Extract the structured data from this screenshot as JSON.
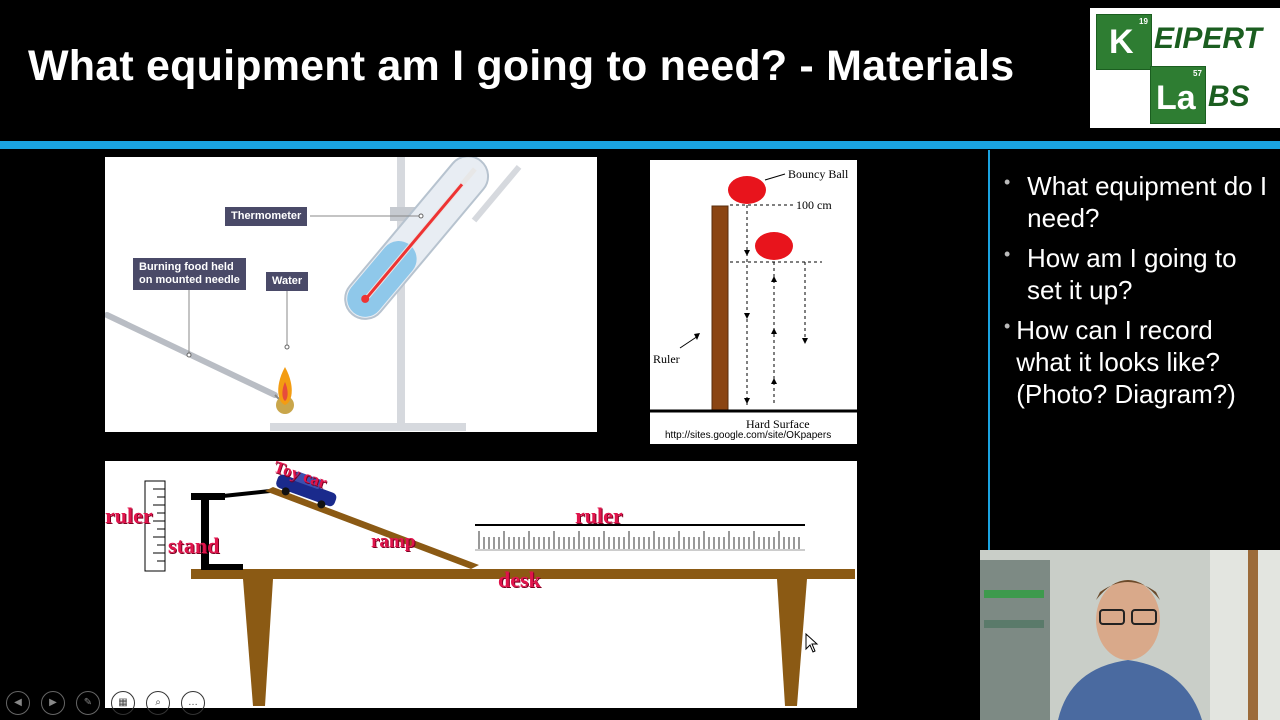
{
  "slide": {
    "title": "What equipment am I going to need? - Materials"
  },
  "logo": {
    "k": "K",
    "k_num": "19",
    "eipert": "EIPERT",
    "la": "La",
    "la_num": "57",
    "bs": "BS"
  },
  "figure1": {
    "thermometer": "Thermometer",
    "burning_food_line1": "Burning food held",
    "burning_food_line2": "on mounted needle",
    "water": "Water"
  },
  "figure2": {
    "bouncy_ball": "Bouncy Ball",
    "height": "100 cm",
    "ruler": "Ruler",
    "surface": "Hard Surface",
    "url": "http://sites.google.com/site/OKpapers"
  },
  "figure3": {
    "ruler_left": "ruler",
    "stand": "stand",
    "toy_car": "Toy car",
    "ramp": "ramp",
    "ruler_right": "ruler",
    "desk": "desk"
  },
  "bullets": [
    "What equipment do I need?",
    "How am I going to set it up?",
    "How can I record what it looks like? (Photo? Diagram?)"
  ],
  "colors": {
    "accent": "#1aa3e0",
    "logo_green": "#2e7d32",
    "ball_red": "#e8141c",
    "desk_brown": "#8b5a14"
  }
}
